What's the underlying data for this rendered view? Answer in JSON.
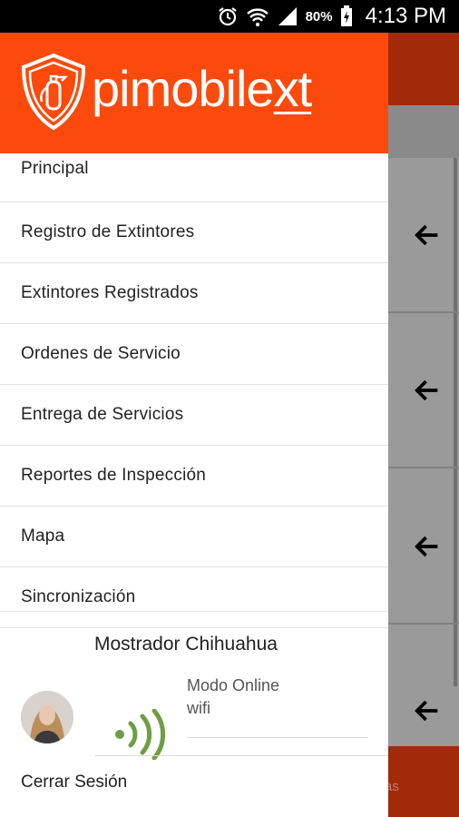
{
  "status_bar": {
    "battery_percent": "80%",
    "time": "4:13 PM"
  },
  "background": {
    "bottom_tab_label_fragment": "as"
  },
  "header": {
    "brand_main": "pimobile",
    "brand_suffix": "xt"
  },
  "menu": {
    "items": [
      {
        "label": "Principal"
      },
      {
        "label": "Registro de Extintores"
      },
      {
        "label": "Extintores Registrados"
      },
      {
        "label": "Ordenes de Servicio"
      },
      {
        "label": "Entrega de Servicios"
      },
      {
        "label": "Reportes de Inspección"
      },
      {
        "label": "Mapa"
      },
      {
        "label": "Sincronización"
      }
    ]
  },
  "user": {
    "name": "Mostrador Chihuahua",
    "mode": "Modo Online",
    "connection": "wifi",
    "status_color": "#6e9d45"
  },
  "logout_label": "Cerrar Sesión",
  "colors": {
    "brand": "#fb4a0b",
    "appbar_dim": "#a12a0b"
  }
}
